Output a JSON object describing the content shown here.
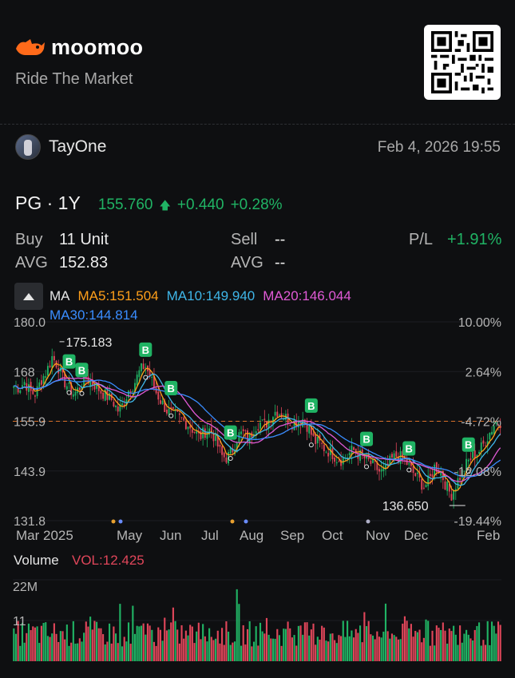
{
  "brand": {
    "name": "moomoo",
    "tagline": "Ride The Market"
  },
  "post": {
    "username": "TayOne",
    "timestamp": "Feb 4, 2026 19:55"
  },
  "quote": {
    "ticker": "PG · 1Y",
    "price": "155.760",
    "change": "+0.440",
    "change_pct": "+0.28%"
  },
  "position": {
    "buy_label": "Buy",
    "buy_value": "11 Unit",
    "sell_label": "Sell",
    "sell_value": "--",
    "pl_label": "P/L",
    "pl_value": "+1.91%",
    "avg_label": "AVG",
    "avg_value": "152.83",
    "avg2_label": "AVG",
    "avg2_value": "--"
  },
  "indicators": {
    "ma_label": "MA",
    "ma5": "MA5:151.504",
    "ma10": "MA10:149.940",
    "ma20": "MA20:146.044",
    "ma30": "MA30:144.814",
    "colors": {
      "ma5": "#ff9f1a",
      "ma10": "#3fb6e8",
      "ma20": "#e05ad6",
      "ma30": "#3a8dff",
      "up": "#20b364",
      "down": "#e0465a"
    }
  },
  "chart_labels": {
    "high_marker": "175.183",
    "low_marker": "136.650",
    "trade_marker": "B"
  },
  "volume": {
    "title": "Volume",
    "value": "VOL:12.425",
    "ticks": [
      "22M",
      "11"
    ]
  },
  "chart_data": {
    "type": "candlestick",
    "y_ticks": [
      "180.0",
      "168",
      "155.9",
      "143.9",
      "131.8"
    ],
    "pct_ticks": [
      "10.00%",
      "2.64%",
      "-4.72%",
      "-12.08%",
      "-19.44%"
    ],
    "x_ticks": [
      "Mar 2025",
      "May",
      "Jun",
      "Jul",
      "Aug",
      "Sep",
      "Oct",
      "Nov",
      "Dec",
      "Feb"
    ],
    "ylim": [
      131.8,
      180.0
    ],
    "reference_price": 155.9,
    "high": 175.183,
    "low": 136.65,
    "close_trend": [
      164.5,
      164.0,
      165.5,
      163.0,
      162.5,
      166.0,
      168.0,
      171.5,
      169.5,
      166.0,
      164.0,
      162.5,
      164.0,
      166.5,
      165.5,
      164.5,
      163.0,
      162.0,
      161.0,
      158.5,
      160.0,
      163.5,
      165.0,
      168.0,
      169.5,
      166.5,
      163.0,
      160.5,
      158.5,
      157.5,
      157.0,
      156.0,
      155.0,
      153.5,
      152.0,
      153.5,
      154.0,
      151.0,
      147.5,
      147.0,
      149.0,
      152.5,
      153.0,
      151.5,
      154.5,
      155.5,
      155.0,
      157.0,
      158.5,
      157.5,
      156.5,
      155.5,
      156.0,
      156.5,
      154.0,
      151.0,
      150.5,
      149.0,
      148.5,
      147.0,
      146.5,
      147.5,
      149.0,
      148.0,
      147.0,
      146.0,
      145.0,
      143.5,
      144.0,
      146.5,
      147.5,
      147.0,
      145.5,
      143.5,
      142.0,
      140.0,
      141.5,
      145.0,
      144.0,
      140.5,
      138.0,
      141.0,
      143.5,
      146.0,
      147.5,
      148.5,
      150.5,
      153.0,
      155.5,
      155.76
    ],
    "buy_markers_index": [
      30,
      34,
      63,
      74,
      94,
      112,
      122,
      138,
      142
    ],
    "volume_max": 22,
    "volume_unit": "M"
  }
}
